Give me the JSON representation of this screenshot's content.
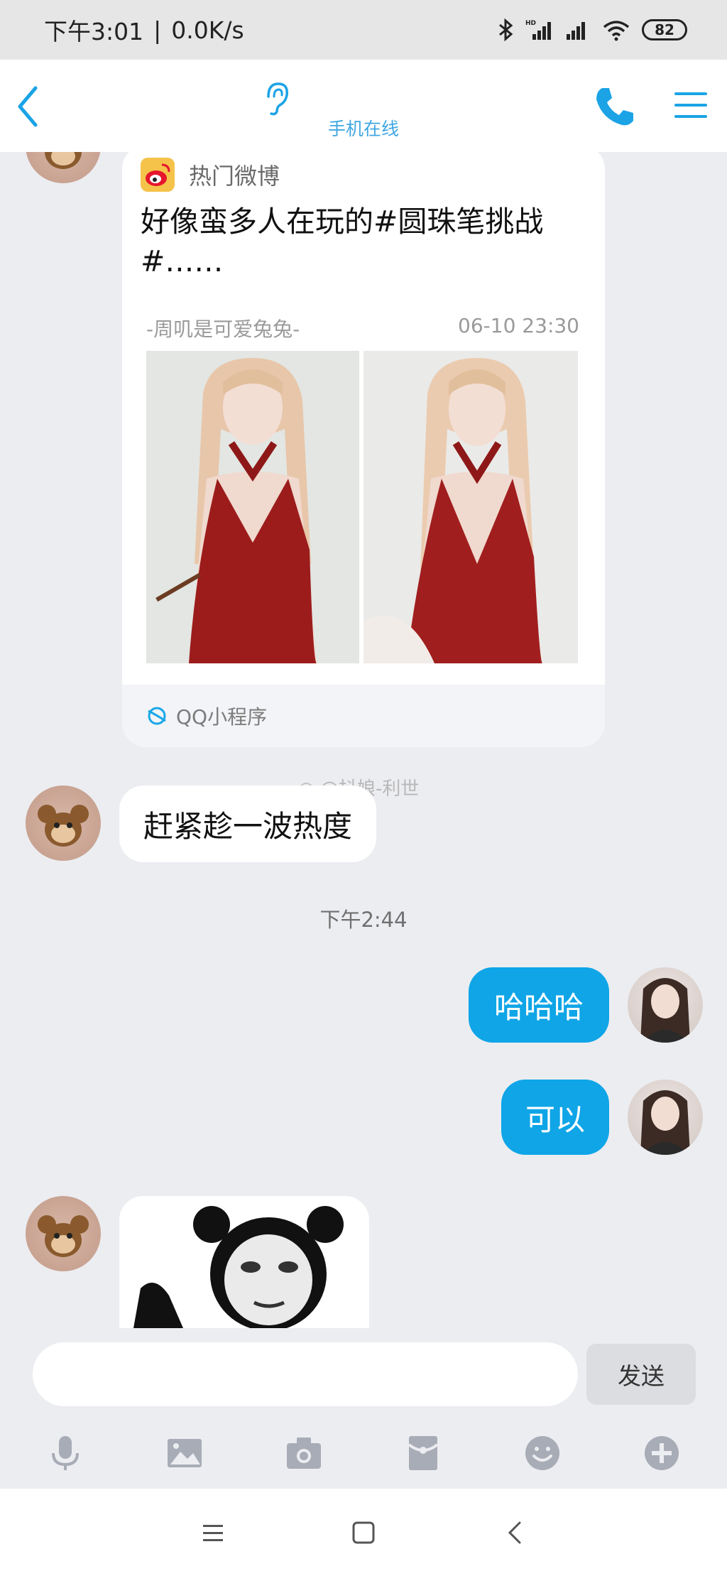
{
  "status_bar": {
    "time": "下午3:01",
    "speed": "0.0K/s",
    "separator": "|",
    "battery": "82"
  },
  "header": {
    "subtitle": "手机在线"
  },
  "messages": {
    "card": {
      "source": "热门微博",
      "title": "好像蛮多人在玩的#圆珠笔挑战#……",
      "author": "-周叽是可爱兔兔-",
      "date": "06-10 23:30",
      "footer": "QQ小程序"
    },
    "text1": "赶紧趁一波热度",
    "watermark": "@抖娘-利世",
    "timestamp": "下午2:44",
    "out1": "哈哈哈",
    "out2": "可以"
  },
  "input": {
    "placeholder": "",
    "send_label": "发送"
  },
  "colors": {
    "accent": "#0fa5e7",
    "header_accent": "#3fa7e2",
    "background": "#ecedf1"
  },
  "icons": [
    "back-icon",
    "ear-icon",
    "phone-icon",
    "menu-icon",
    "mic-icon",
    "image-icon",
    "camera-icon",
    "redpacket-icon",
    "emoji-icon",
    "plus-icon"
  ]
}
